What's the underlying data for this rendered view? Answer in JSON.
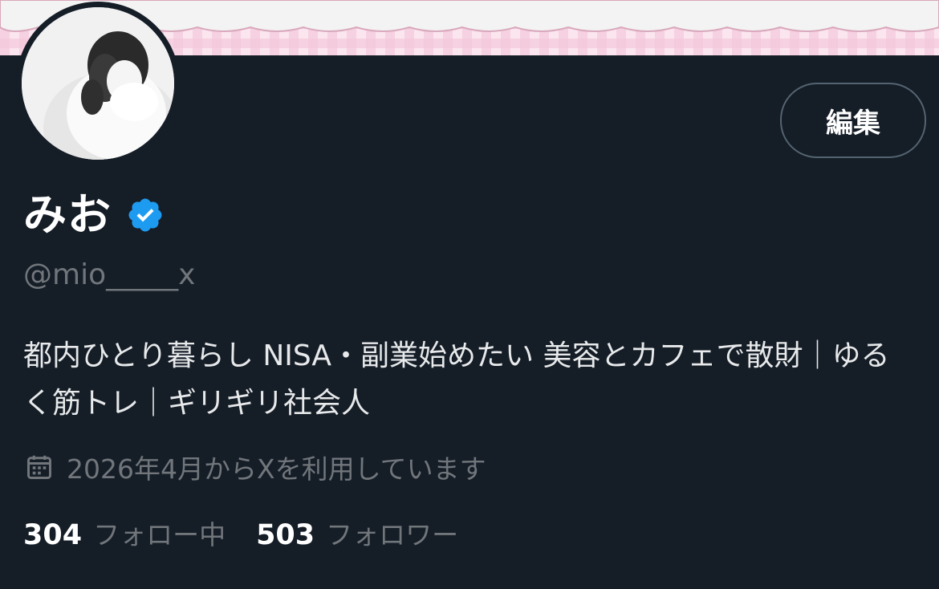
{
  "profile": {
    "display_name": "みお",
    "verified_icon": "verified-badge-icon",
    "handle": "@mio_____x",
    "bio": "都内ひとり暮らし NISA・副業始めたい 美容とカフェで散財｜ゆるく筋トレ｜ギリギリ社会人",
    "joined": "2026年4月からXを利用しています",
    "following_count": "304",
    "following_label": "フォロー中",
    "followers_count": "503",
    "followers_label": "フォロワー"
  },
  "actions": {
    "edit_label": "編集"
  },
  "colors": {
    "background": "#151d27",
    "verified": "#1d9bf0",
    "muted_text": "#71767b",
    "banner_pink": "#f4c8dc"
  }
}
